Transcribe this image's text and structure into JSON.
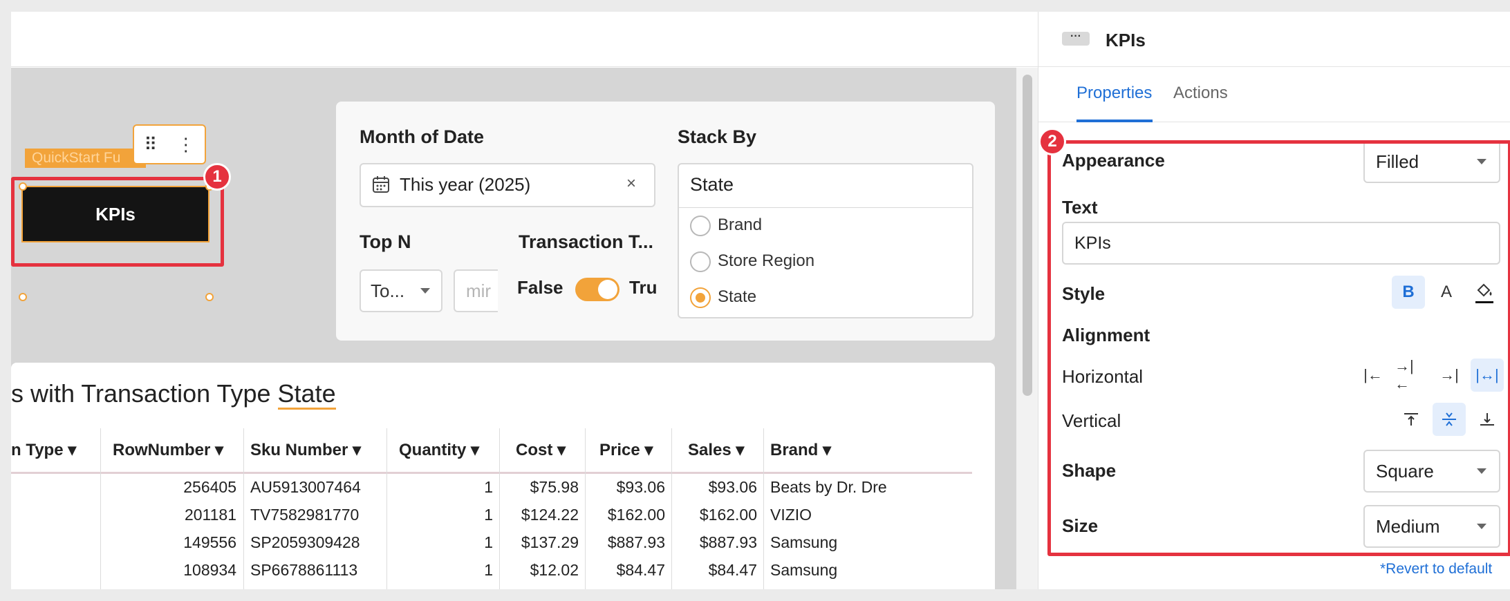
{
  "panel": {
    "title": "KPIs",
    "more_icon": "ellipsis-icon",
    "tabs": [
      {
        "label": "Properties",
        "active": true
      },
      {
        "label": "Actions",
        "active": false
      }
    ],
    "appearance": {
      "label": "Appearance",
      "value": "Filled"
    },
    "text": {
      "label": "Text",
      "value": "KPIs"
    },
    "style": {
      "label": "Style",
      "icons": [
        "bold-icon",
        "text-color-icon",
        "fill-color-icon"
      ],
      "bold_glyph": "B",
      "font_glyph": "A"
    },
    "alignment": {
      "label": "Alignment",
      "horizontal_label": "Horizontal",
      "vertical_label": "Vertical",
      "horizontal_selected": "stretch",
      "vertical_selected": "center"
    },
    "shape": {
      "label": "Shape",
      "value": "Square"
    },
    "size": {
      "label": "Size",
      "value": "Medium"
    },
    "revert": "*Revert to default"
  },
  "canvas": {
    "element_tab": "QuickStart Fu",
    "kpi_button": "KPIs",
    "badge_1": "1",
    "badge_2": "2"
  },
  "controls": {
    "month_of_date": {
      "label": "Month of Date",
      "value": "This year (2025)"
    },
    "stack_by": {
      "label": "Stack By",
      "value": "State",
      "options": [
        {
          "label": "Brand",
          "selected": false
        },
        {
          "label": "Store Region",
          "selected": false
        },
        {
          "label": "State",
          "selected": true
        }
      ]
    },
    "top_n": {
      "label": "Top N",
      "value": "To...",
      "min_placeholder": "mir"
    },
    "transaction_type": {
      "label": "Transaction T...",
      "false_label": "False",
      "true_label": "Tru",
      "on": true
    }
  },
  "table": {
    "title_prefix": "s with Transaction Type ",
    "title_highlight": "State",
    "columns": [
      "n Type",
      "RowNumber",
      "Sku Number",
      "Quantity",
      "Cost",
      "Price",
      "Sales",
      "Brand"
    ],
    "rows": [
      {
        "row": "256405",
        "sku": "AU5913007464",
        "qty": "1",
        "cost": "$75.98",
        "price": "$93.06",
        "sales": "$93.06",
        "brand": "Beats by Dr. Dre"
      },
      {
        "row": "201181",
        "sku": "TV7582981770",
        "qty": "1",
        "cost": "$124.22",
        "price": "$162.00",
        "sales": "$162.00",
        "brand": "VIZIO"
      },
      {
        "row": "149556",
        "sku": "SP2059309428",
        "qty": "1",
        "cost": "$137.29",
        "price": "$887.93",
        "sales": "$887.93",
        "brand": "Samsung"
      },
      {
        "row": "108934",
        "sku": "SP6678861113",
        "qty": "1",
        "cost": "$12.02",
        "price": "$84.47",
        "sales": "$84.47",
        "brand": "Samsung"
      }
    ]
  },
  "colors": {
    "accent": "#f2a33a",
    "annotation": "#e5323f",
    "link": "#1f6fd6"
  }
}
